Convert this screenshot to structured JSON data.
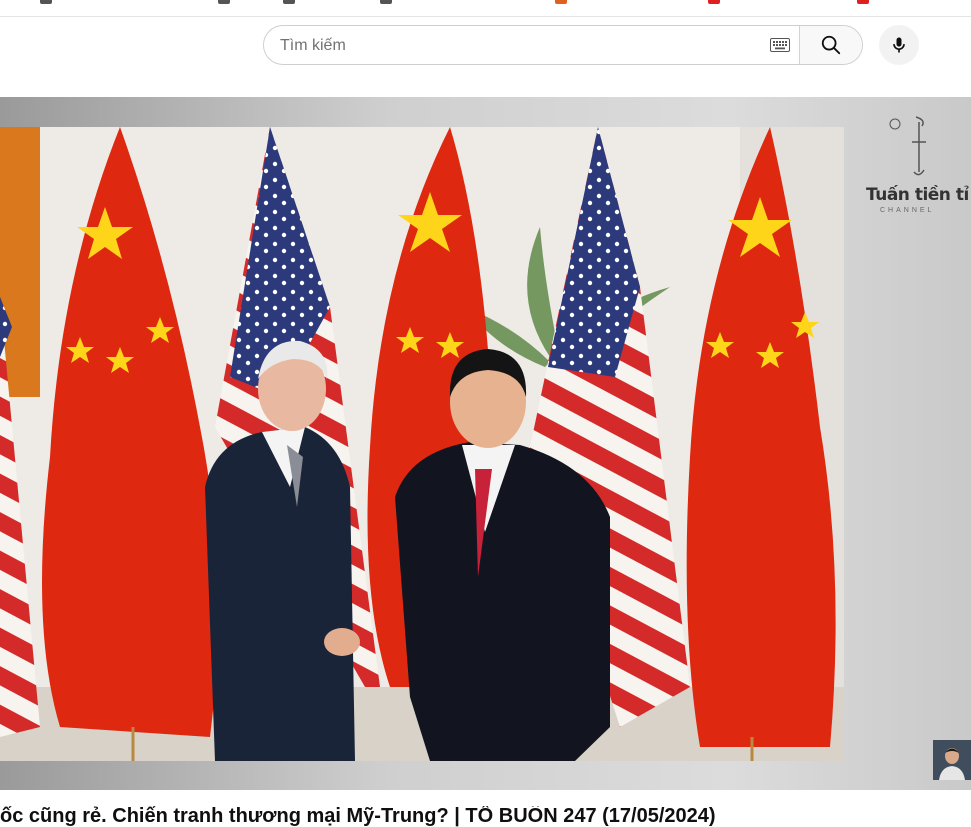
{
  "search": {
    "placeholder": "Tìm kiếm",
    "value": "",
    "keyboard_icon": "keyboard-icon",
    "search_icon": "search-icon",
    "mic_icon": "microphone-icon"
  },
  "video": {
    "title": "ốc cũng rẻ. Chiến tranh thương mại Mỹ-Trung? | TỔ BUÔN 247 (17/05/2024)",
    "watermark": {
      "name": "Tuấn tiền tỉ",
      "sub": "CHANNEL"
    }
  },
  "colors": {
    "flag_red": "#de2910",
    "flag_star": "#ffde00",
    "us_blue": "#3c3b6e",
    "background": "#ffffff"
  }
}
